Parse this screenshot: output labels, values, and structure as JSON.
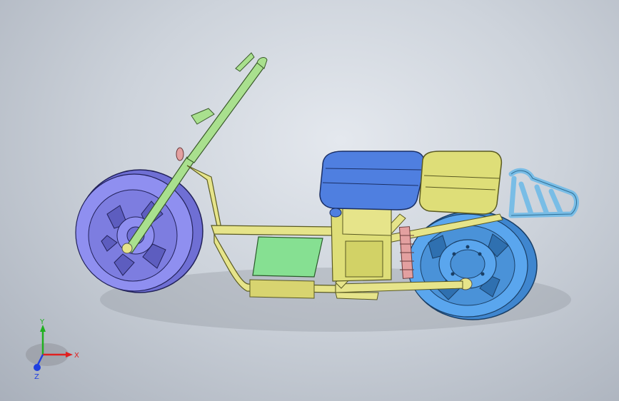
{
  "viewport": {
    "background_top": "#e4e8ee",
    "background_bottom": "#a9b0bb"
  },
  "model": {
    "colors": {
      "frame": "#e6e48a",
      "front_wheel": "#8f8ff0",
      "rear_wheel": "#5aa6ee",
      "seat": "#4f7fe0",
      "battery_box": "#dede78",
      "floor_pad": "#86e092",
      "fork": "#a9e08e",
      "spring": "#e3a0a0",
      "rack": "#79bde6"
    }
  },
  "triad": {
    "x_label": "X",
    "y_label": "Y",
    "z_label": "Z",
    "x_color": "#e02020",
    "y_color": "#20b020",
    "z_color": "#2040e0"
  }
}
